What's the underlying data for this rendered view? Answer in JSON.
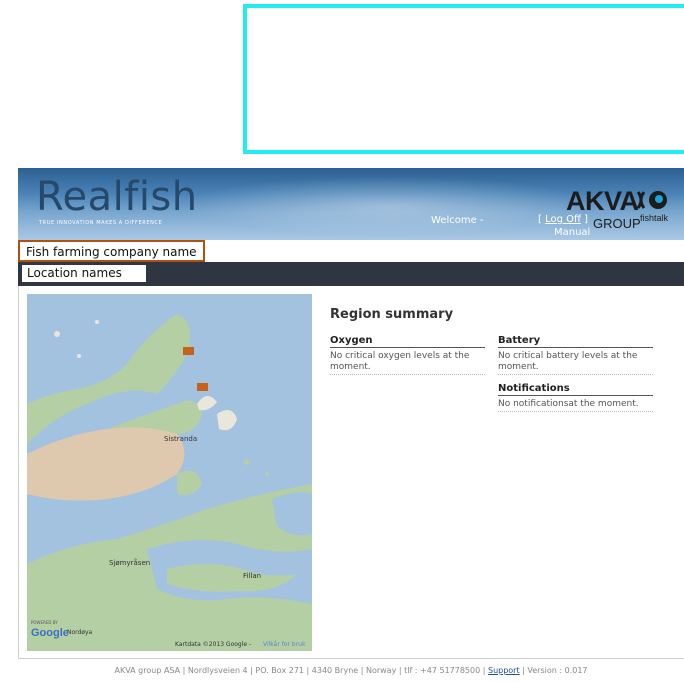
{
  "banner": {
    "logo": "Realfish",
    "tagline": "TRUE INNOVATION MAKES A DIFFERENCE",
    "welcome": "Welcome -",
    "logoff_open": "[",
    "logoff": "Log Off",
    "logoff_close": "]",
    "manual": "Manual",
    "brand": "AKVA",
    "brand_sub": "GROUP",
    "product": "fishtalk"
  },
  "company_name": "Fish farming company name",
  "location_names": "Location names",
  "map": {
    "labels": {
      "sistranda": "Sistranda",
      "sjomyrasen": "Sjømyråsen",
      "fillan": "Fillan",
      "nordoya": "Nordøya"
    },
    "powered_by": "POWERED BY",
    "google": "Google",
    "attribution": "Kartdata ©2013 Google -",
    "terms": "Vilkår for bruk",
    "marker_color": "#c8621a"
  },
  "summary": {
    "title": "Region summary",
    "oxygen_title": "Oxygen",
    "oxygen_text": "No critical oxygen levels at the moment.",
    "battery_title": "Battery",
    "battery_text": "No critical battery levels at the moment.",
    "notifications_title": "Notifications",
    "notifications_text": "No notificationsat the moment."
  },
  "footer": {
    "text": "AKVA group ASA | Nordlysveien 4 | PO. Box 271 | 4340 Bryne | Norway | tlf : +47 51778500 |",
    "support": "Support",
    "version": "| Version : 0.017"
  }
}
